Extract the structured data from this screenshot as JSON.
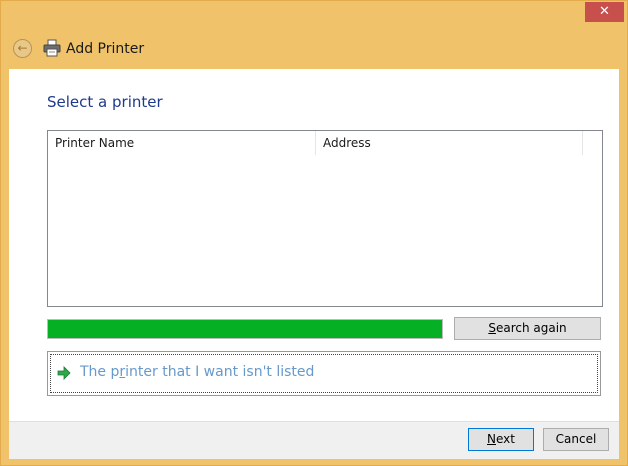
{
  "window": {
    "title": "Add Printer",
    "close_glyph": "✕"
  },
  "header": {
    "back_glyph": "←"
  },
  "main": {
    "section_title": "Select a printer",
    "list": {
      "columns": [
        "Printer Name",
        "Address"
      ],
      "rows": []
    },
    "progress": {
      "percent": 100,
      "color": "#06b025"
    },
    "search_again": {
      "pre": "",
      "accel": "S",
      "post": "earch again"
    },
    "not_listed": {
      "pre": "The p",
      "accel": "r",
      "post": "inter that I want isn't listed"
    }
  },
  "footer": {
    "next": {
      "pre": "",
      "accel": "N",
      "post": "ext"
    },
    "cancel_label": "Cancel"
  },
  "icons": {
    "back": "back-arrow-icon",
    "printer": "printer-icon",
    "arrow": "green-arrow-icon",
    "close": "close-icon"
  }
}
